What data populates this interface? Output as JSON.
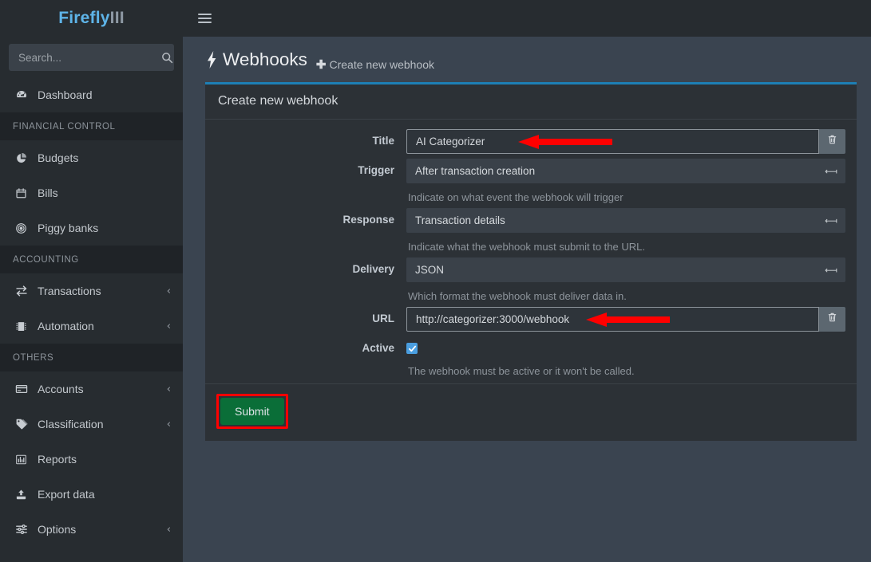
{
  "brand": {
    "name": "Firefly",
    "suffix": "III"
  },
  "sidebar": {
    "search": {
      "value": "",
      "placeholder": "Search...",
      "icon": "search-icon"
    },
    "groups": [
      {
        "header": null,
        "items": [
          {
            "label": "Dashboard",
            "icon": "tachometer-icon",
            "caret": null
          }
        ]
      },
      {
        "header": "FINANCIAL CONTROL",
        "items": [
          {
            "label": "Budgets",
            "icon": "pie-chart-icon",
            "caret": null
          },
          {
            "label": "Bills",
            "icon": "calendar-icon",
            "caret": null
          },
          {
            "label": "Piggy banks",
            "icon": "bullseye-icon",
            "caret": null
          }
        ]
      },
      {
        "header": "ACCOUNTING",
        "items": [
          {
            "label": "Transactions",
            "icon": "exchange-icon",
            "caret": "‹"
          },
          {
            "label": "Automation",
            "icon": "memory-icon",
            "caret": "‹"
          }
        ]
      },
      {
        "header": "OTHERS",
        "items": [
          {
            "label": "Accounts",
            "icon": "credit-card-icon",
            "caret": "‹"
          },
          {
            "label": "Classification",
            "icon": "tag-icon",
            "caret": "‹"
          },
          {
            "label": "Reports",
            "icon": "bar-chart-icon",
            "caret": null
          },
          {
            "label": "Export data",
            "icon": "upload-icon",
            "caret": null
          },
          {
            "label": "Options",
            "icon": "sliders-icon",
            "caret": "‹"
          }
        ]
      }
    ]
  },
  "topbar": {
    "menu_icon": "hamburger-icon"
  },
  "page": {
    "title": "Webhooks",
    "title_icon": "bolt-icon",
    "create_link": "Create new webhook",
    "create_icon": "plus-icon"
  },
  "card": {
    "header": "Create new webhook",
    "accent_color": "#1d7fb5",
    "fields": [
      {
        "label": "Title",
        "type": "text",
        "value": "AI Categorizer",
        "placeholder": "",
        "has_trash": true,
        "trash_icon": "trash-icon",
        "help": null
      },
      {
        "label": "Trigger",
        "type": "select",
        "value": "After transaction creation",
        "caret_icon": "chevron-down-icon",
        "help": "Indicate on what event the webhook will trigger"
      },
      {
        "label": "Response",
        "type": "select",
        "value": "Transaction details",
        "caret_icon": "chevron-down-icon",
        "help": "Indicate what the webhook must submit to the URL."
      },
      {
        "label": "Delivery",
        "type": "select",
        "value": "JSON",
        "caret_icon": "chevron-down-icon",
        "help": "Which format the webhook must deliver data in."
      },
      {
        "label": "URL",
        "type": "text",
        "value": "http://categorizer:3000/webhook",
        "placeholder": "",
        "has_trash": true,
        "trash_icon": "trash-icon",
        "help": null
      },
      {
        "label": "Active",
        "type": "checkbox",
        "checked": true,
        "help": "The webhook must be active or it won't be called."
      }
    ],
    "submit_label": "Submit",
    "submit_color": "#0a6e38"
  },
  "annotations": {
    "arrow_color": "#ff0000",
    "highlight_color": "#ff0000",
    "arrows": [
      {
        "target": "title-field"
      },
      {
        "target": "url-field"
      }
    ],
    "highlight": {
      "target": "submit-button"
    }
  }
}
